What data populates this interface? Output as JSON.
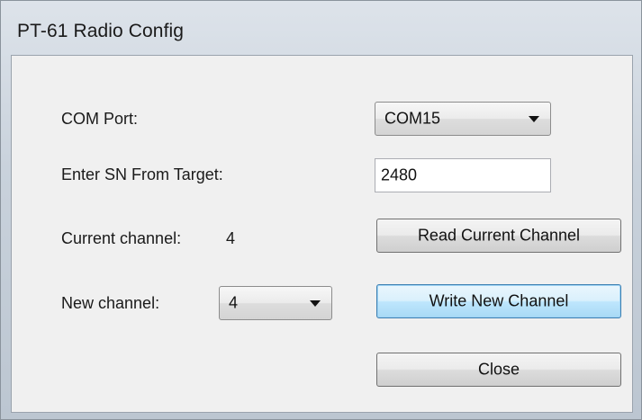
{
  "window": {
    "title": "PT-61 Radio Config"
  },
  "form": {
    "com_port_label": "COM Port:",
    "com_port_value": "COM15",
    "sn_label": "Enter SN From Target:",
    "sn_value": "2480",
    "current_channel_label": "Current channel:",
    "current_channel_value": "4",
    "new_channel_label": "New channel:",
    "new_channel_value": "4"
  },
  "buttons": {
    "read_label": "Read Current Channel",
    "write_label": "Write New Channel",
    "close_label": "Close"
  }
}
